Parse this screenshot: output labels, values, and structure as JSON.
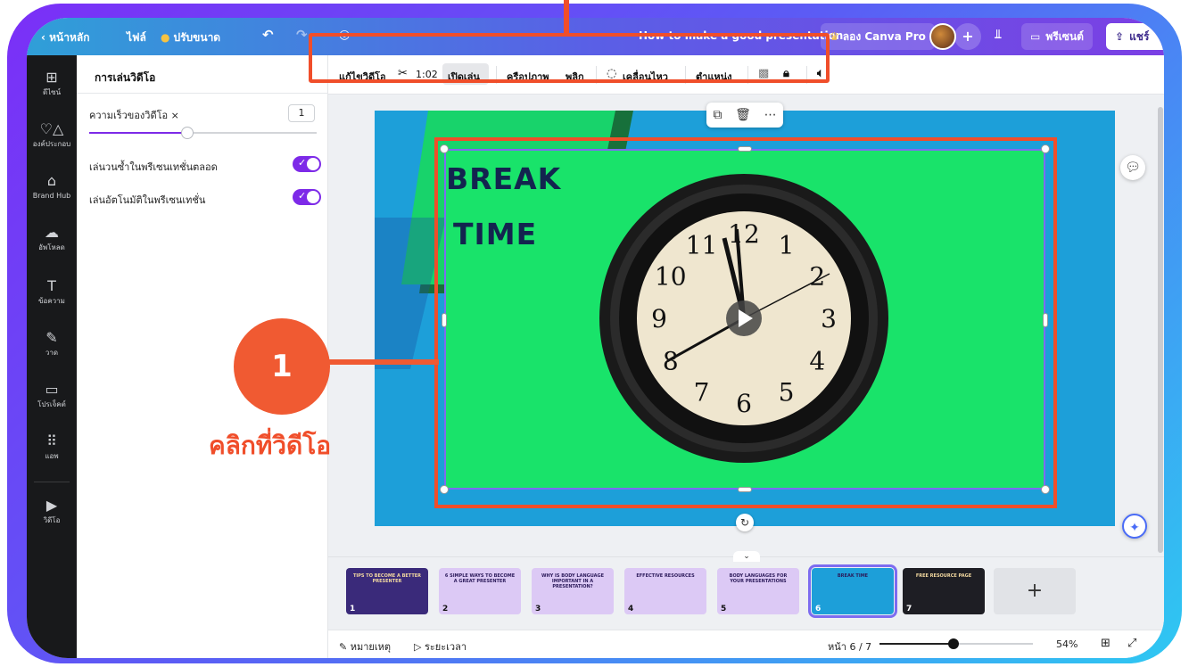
{
  "topbar": {
    "home": "หน้าหลัก",
    "file": "ไฟล์",
    "resize": "ปรับขนาด",
    "doc_title": "How to make a good presentation",
    "try_pro": "ลอง Canva Pro",
    "present": "พรีเซนต์",
    "share": "แชร์"
  },
  "rail": {
    "items": [
      {
        "label": "ดีไซน์",
        "icon": "layout-icon"
      },
      {
        "label": "องค์ประกอบ",
        "icon": "elements-icon"
      },
      {
        "label": "Brand Hub",
        "icon": "brand-icon"
      },
      {
        "label": "อัพโหลด",
        "icon": "upload-icon"
      },
      {
        "label": "ข้อความ",
        "icon": "text-icon"
      },
      {
        "label": "วาด",
        "icon": "draw-icon"
      },
      {
        "label": "โปรเจ็คต์",
        "icon": "folder-icon"
      },
      {
        "label": "แอพ",
        "icon": "apps-icon"
      },
      {
        "label": "วิดีโอ",
        "icon": "video-icon"
      }
    ]
  },
  "panel": {
    "title": "การเล่นวิดีโอ",
    "speed_label": "ความเร็วของวิดีโอ ×",
    "speed_value": "1",
    "speed_fraction": 0.43,
    "loop_label": "เล่นวนซ้ำในพรีเซนเทชั่นตลอด",
    "autoplay_label": "เล่นอัตโนมัติในพรีเซนเทชั่น",
    "loop_on": true,
    "autoplay_on": true
  },
  "toolbar": {
    "edit_video": "แก้ไขวิดีโอ",
    "duration": "1:02",
    "play": "เปิดเล่น",
    "crop": "ครือปภาพ",
    "flip": "พลิก",
    "animate": "เคลื่อนไหว",
    "position": "ตำแหน่ง"
  },
  "slide": {
    "title_line1": "BREAK",
    "title_line2": "TIME",
    "clock_numbers": [
      "12",
      "1",
      "2",
      "3",
      "4",
      "5",
      "6",
      "7",
      "8",
      "9",
      "10",
      "11"
    ]
  },
  "annotation": {
    "step": "1",
    "label": "คลิกที่วิดีโอ"
  },
  "thumbnails": [
    {
      "num": "1",
      "text": "TIPS TO BECOME A BETTER PRESENTER",
      "bg": "#3a2a7a"
    },
    {
      "num": "2",
      "text": "6 SIMPLE WAYS TO BECOME A GREAT PRESENTER",
      "bg": "#dcc9f5"
    },
    {
      "num": "3",
      "text": "WHY IS BODY LANGUAGE IMPORTANT IN A PRESENTATION?",
      "bg": "#dcc9f5"
    },
    {
      "num": "4",
      "text": "EFFECTIVE RESOURCES",
      "bg": "#dcc9f5"
    },
    {
      "num": "5",
      "text": "BODY LANGUAGES FOR YOUR PRESENTATIONS",
      "bg": "#dcc9f5"
    },
    {
      "num": "6",
      "text": "BREAK TIME",
      "bg": "#1d9fd9"
    },
    {
      "num": "7",
      "text": "FREE RESOURCE PAGE",
      "bg": "#1e1e24"
    }
  ],
  "footer": {
    "notes": "หมายเหตุ",
    "timing": "ระยะเวลา",
    "page": "หน้า 6 / 7",
    "zoom": "54%",
    "zoom_fraction": 0.48
  },
  "colors": {
    "accent": "#7d2ae8",
    "callout": "#f04e2a",
    "video_bg": "#19e36a",
    "slide_bg": "#1d9fd9"
  }
}
